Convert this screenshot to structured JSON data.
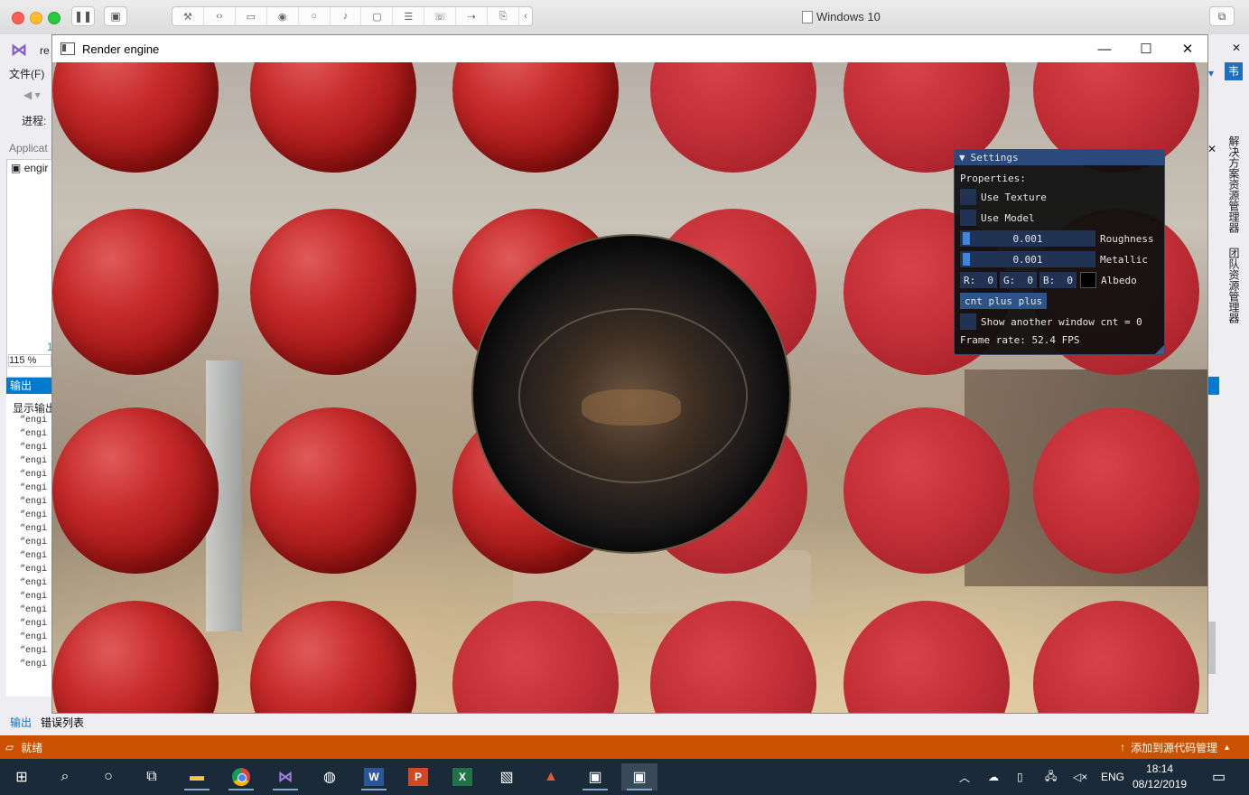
{
  "host": {
    "title": "Windows 10",
    "toolbar_icons": [
      "wrench-icon",
      "code-icon",
      "drive-icon",
      "user-icon",
      "user-outline-icon",
      "speaker-icon",
      "camera-icon",
      "printer-icon",
      "phone-icon",
      "usb-icon",
      "share-icon",
      "chevron-left-icon"
    ]
  },
  "vs": {
    "app_title_partial": "re",
    "menu_file": "文件(F)",
    "progress_label": "进程:",
    "panel_title": "Applicat",
    "panel_item": "engir",
    "zoom": "115 %",
    "line_no": "1",
    "output_tab": "输出",
    "output_show": "显示输出",
    "output_lines": [
      "“engi",
      "“engi",
      "“engi",
      "“engi",
      "“engi",
      "“engi",
      "“engi",
      "“engi",
      "“engi",
      "“engi",
      "“engi",
      "“engi",
      "“engi",
      "“engi",
      "“engi",
      "“engi",
      "“engi",
      "“engi",
      "“engi"
    ],
    "bottom_tabs": [
      "输出",
      "错误列表"
    ],
    "right_vertical_1": "解决方案资源管理器",
    "right_vertical_2": "团队资源管理器",
    "status_ready": "就绪",
    "status_source_control": "添加到源代码管理",
    "status_source_control_arrow": "▲"
  },
  "render_window": {
    "title": "Render engine",
    "controls": {
      "minimize": "—",
      "maximize": "☐",
      "close": "✕"
    }
  },
  "settings": {
    "title": "Settings",
    "properties_label": "Properties:",
    "use_texture": "Use Texture",
    "use_model": "Use Model",
    "roughness_value": "0.001",
    "roughness_label": "Roughness",
    "metallic_value": "0.001",
    "metallic_label": "Metallic",
    "r_label": "R:",
    "r_value": "0",
    "g_label": "G:",
    "g_value": "0",
    "b_label": "B:",
    "b_value": "0",
    "albedo_label": "Albedo",
    "albedo_color": "#000000",
    "button_label": "cnt plus plus",
    "show_window_label": "Show another window cnt = 0",
    "frame_rate": "Frame rate: 52.4 FPS"
  },
  "taskbar": {
    "apps": [
      "start-icon",
      "search-icon",
      "cortana-icon",
      "task-view-icon",
      "file-explorer-icon",
      "chrome-icon",
      "visual-studio-icon",
      "steam-icon",
      "word-icon",
      "powerpoint-icon",
      "excel-icon",
      "photos-icon",
      "blender-icon",
      "render-app-icon",
      "render-app-icon-2"
    ],
    "lang": "ENG",
    "time": "18:14",
    "date": "08/12/2019"
  }
}
